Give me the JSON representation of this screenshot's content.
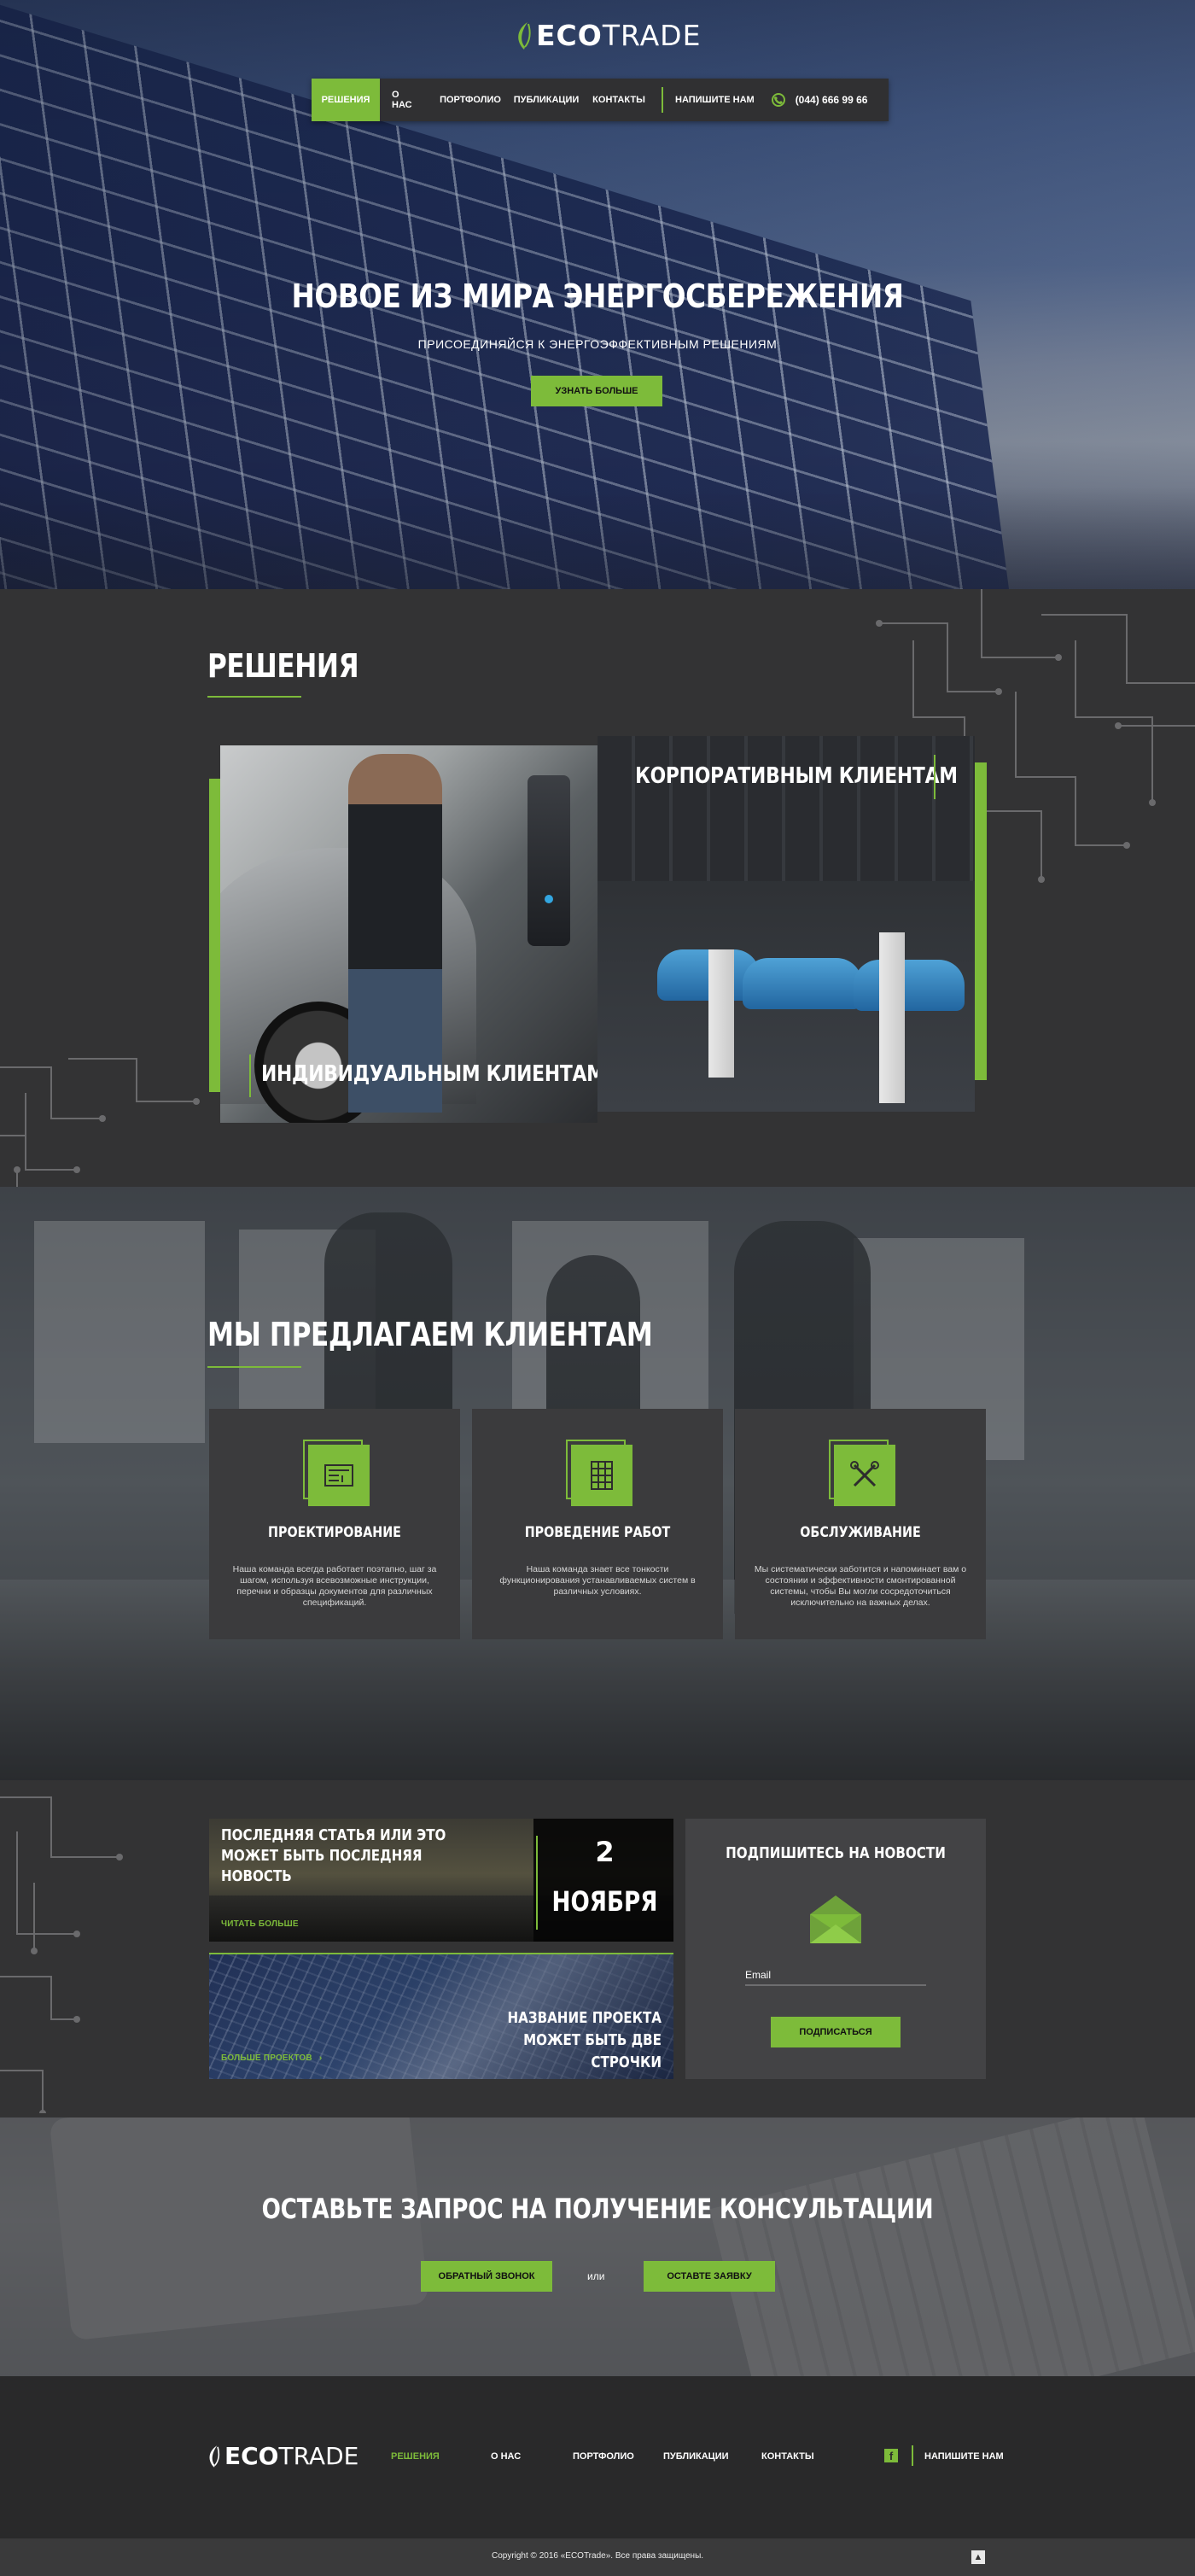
{
  "brand": {
    "eco": "ECO",
    "trade": "TRADE",
    "accent": "#7dbb3a"
  },
  "nav": {
    "items": [
      {
        "label": "РЕШЕНИЯ",
        "active": true
      },
      {
        "label": "О НАС"
      },
      {
        "label": "ПОРТФОЛИО"
      },
      {
        "label": "ПУБЛИКАЦИИ"
      },
      {
        "label": "КОНТАКТЫ"
      }
    ],
    "write_us": "НАПИШИТЕ НАМ",
    "phone": "(044) 666 99 66"
  },
  "hero": {
    "title": "НОВОЕ ИЗ МИРА ЭНЕРГОСБЕРЕЖЕНИЯ",
    "subtitle": "ПРИСОЕДИНЯЙСЯ К ЭНЕРГОЭФФЕКТИВНЫМ РЕШЕНИЯМ",
    "button": "УЗНАТЬ БОЛЬШЕ"
  },
  "solutions": {
    "title": "РЕШЕНИЯ",
    "individual": "ИНДИВИДУАЛЬНЫМ КЛИЕНТАМ",
    "corporate": "КОРПОРАТИВНЫМ КЛИЕНТАМ"
  },
  "offer": {
    "title": "МЫ ПРЕДЛАГАЕМ КЛИЕНТАМ",
    "cards": [
      {
        "icon": "blueprint-icon",
        "title": "ПРОЕКТИРОВАНИЕ",
        "text": "Наша команда всегда работает поэтапно, шаг за шагом, используя всевозможные инструкции, перечни и образцы документов для различных спецификаций."
      },
      {
        "icon": "solar-panel-icon",
        "title": "ПРОВЕДЕНИЕ РАБОТ",
        "text": "Наша команда знает все тонкости функционирования устанавливаемых систем в различных условиях."
      },
      {
        "icon": "tools-icon",
        "title": "ОБСЛУЖИВАНИЕ",
        "text": "Мы систематически заботится и напоминает вам о состоянии и эффективности смонтированной системы, чтобы Вы могли сосредоточиться исключительно на важных делах."
      }
    ]
  },
  "news": {
    "article_title": "ПОСЛЕДНЯЯ СТАТЬЯ ИЛИ ЭТО МОЖЕТ БЫТЬ ПОСЛЕДНЯЯ НОВОСТЬ",
    "read_more": "ЧИТАТЬ БОЛЬШЕ",
    "day": "2",
    "month": "НОЯБРЯ",
    "project_title": "НАЗВАНИЕ ПРОЕКТА МОЖЕТ БЫТЬ ДВЕ СТРОЧКИ",
    "more_projects": "БОЛЬШЕ ПРОЕКТОВ"
  },
  "subscribe": {
    "title": "ПОДПИШИТЕСЬ НА НОВОСТИ",
    "email_label": "Email",
    "button": "ПОДПИСАТЬСЯ"
  },
  "cta": {
    "title": "ОСТАВЬТЕ ЗАПРОС НА ПОЛУЧЕНИЕ КОНСУЛЬТАЦИИ",
    "callback": "ОБРАТНЫЙ ЗВОНОК",
    "or": "или",
    "request": "ОСТАВТЕ ЗАЯВКУ"
  },
  "footer": {
    "nav": [
      "РЕШЕНИЯ",
      "О НАС",
      "ПОРТФОЛИО",
      "ПУБЛИКАЦИИ",
      "КОНТАКТЫ"
    ],
    "write_us": "НАПИШИТЕ НАМ",
    "copyright": "Copyright © 2016 «ECOTrade». Все права защищены."
  }
}
